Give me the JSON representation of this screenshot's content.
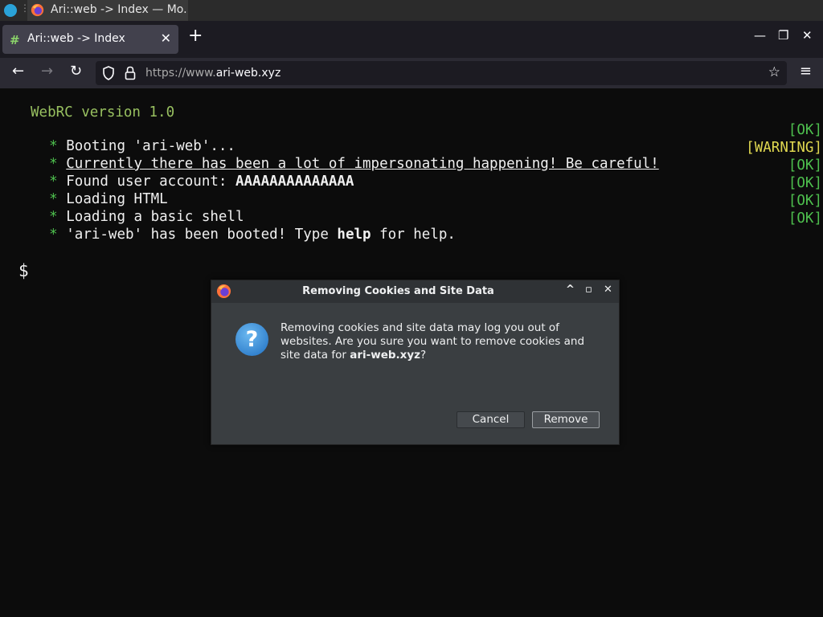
{
  "taskbar": {
    "window_title": "Ari::web -> Index — Mo..."
  },
  "browser": {
    "tab": {
      "title": "Ari::web -> Index",
      "favicon": "#"
    },
    "url_prefix": "https://www.",
    "url_domain": "ari-web.xyz"
  },
  "terminal": {
    "version": "WebRC version 1.0",
    "lines": [
      {
        "bullet": "*",
        "text": "Booting 'ari-web'...",
        "status": "[OK]"
      },
      {
        "bullet": "*",
        "text": "Currently there has been a lot of impersonating happening! Be careful!",
        "status": "[WARNING]"
      },
      {
        "bullet": "*",
        "text_a": "Found user account: ",
        "text_b": "AAAAAAAAAAAAAA",
        "status": "[OK]"
      },
      {
        "bullet": "*",
        "text": "Loading HTML",
        "status": "[OK]"
      },
      {
        "bullet": "*",
        "text": "Loading a basic shell",
        "status": "[OK]"
      },
      {
        "bullet": "*",
        "text_a": "'ari-web' has been booted! Type ",
        "text_b": "help",
        "text_c": " for help.",
        "status": "[OK]"
      }
    ],
    "prompt": "$"
  },
  "dialog": {
    "title": "Removing Cookies and Site Data",
    "message_a": "Removing cookies and site data may log you out of websites. Are you sure you want to remove cookies and site data for ",
    "message_domain": "ari-web.xyz",
    "message_b": "?",
    "question_glyph": "?",
    "cancel_label": "Cancel",
    "remove_label": "Remove"
  },
  "colors": {
    "ok": "#4ec04e",
    "warning": "#e0d850",
    "version": "#98c060"
  }
}
